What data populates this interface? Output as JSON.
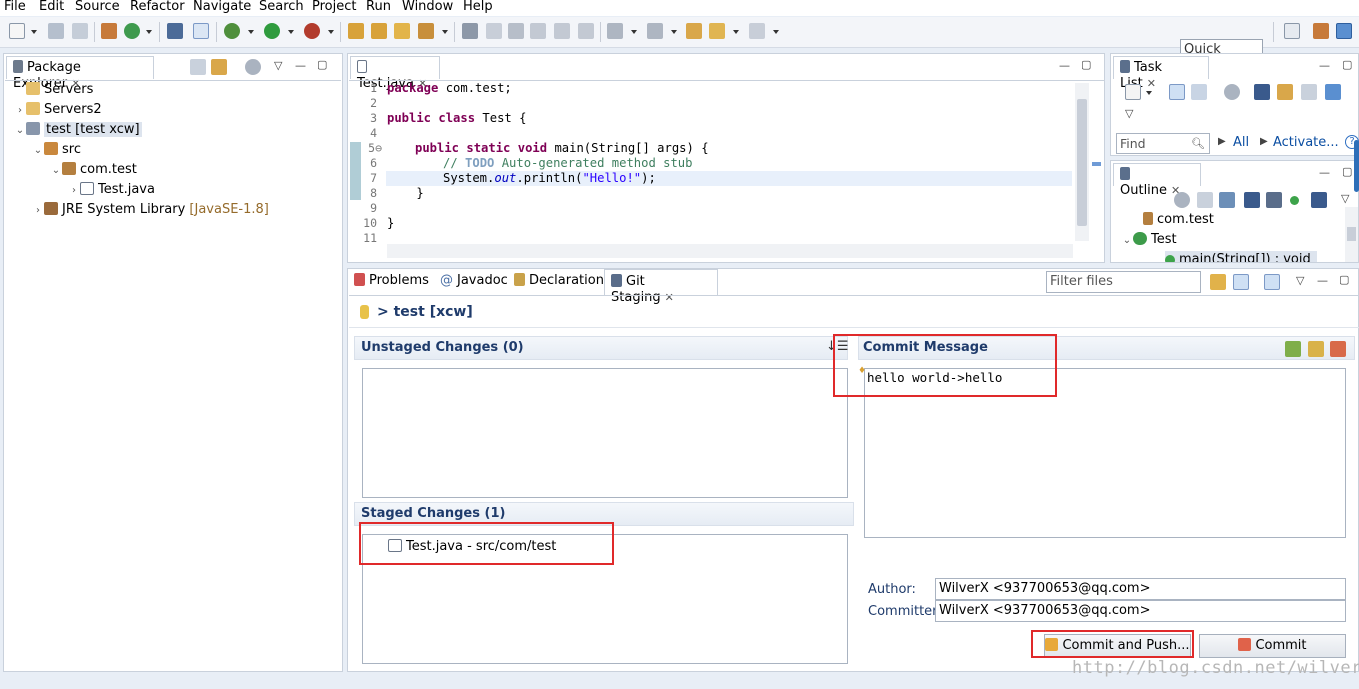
{
  "menu": [
    "File",
    "Edit",
    "Source",
    "Refactor",
    "Navigate",
    "Search",
    "Project",
    "Run",
    "Window",
    "Help"
  ],
  "quick_access": "Quick Access",
  "package_explorer": {
    "tab_label": "Package Explorer",
    "tree": [
      {
        "label": "Servers",
        "extra": "",
        "twisty": "",
        "icon": "folder-icon"
      },
      {
        "label": "Servers2",
        "extra": "",
        "twisty": "›",
        "icon": "folder-icon"
      },
      {
        "label": "test [test xcw]",
        "extra": "",
        "twisty": "⌄",
        "icon": "java-project-icon"
      },
      {
        "label": "src",
        "extra": "",
        "twisty": "⌄",
        "icon": "source-folder-icon"
      },
      {
        "label": "com.test",
        "extra": "",
        "twisty": "⌄",
        "icon": "package-icon"
      },
      {
        "label": "Test.java",
        "extra": "",
        "twisty": "›",
        "icon": "java-file-icon"
      },
      {
        "label": "JRE System Library",
        "extra": "[JavaSE-1.8]",
        "twisty": "›",
        "icon": "library-icon"
      }
    ]
  },
  "editor": {
    "tab_label": "Test.java",
    "line_numbers": [
      "1",
      "2",
      "3",
      "4",
      "5⊖",
      "6",
      "7",
      "8",
      "9",
      "10",
      "11"
    ]
  },
  "code": {
    "l1_kw": "package",
    "l1_rest": " com.test;",
    "l3_kw1": "public",
    "l3_kw2": "class",
    "l3_rest": " Test {",
    "l5_kw1": "public",
    "l5_kw2": "static",
    "l5_kw3": "void",
    "l5_rest": " main(String[] args) {",
    "l6_cm1": "// ",
    "l6_todo": "TODO",
    "l6_cm2": " Auto-generated method stub",
    "l7_a": "System.",
    "l7_fld": "out",
    "l7_b": ".println(",
    "l7_str": "\"Hello!\"",
    "l7_c": ");",
    "l8": "    }",
    "l10": "}"
  },
  "task_list": {
    "tab_label": "Task List",
    "find_placeholder": "Find",
    "all_link": "All",
    "activate_link": "Activate..."
  },
  "outline": {
    "tab_label": "Outline",
    "items": [
      "com.test",
      "Test",
      "main(String[]) : void"
    ]
  },
  "bottom_tabs": [
    "Problems",
    "Javadoc",
    "Declaration",
    "Git Staging"
  ],
  "filter_placeholder": "Filter files",
  "git_staging": {
    "repo_title": "> test [xcw]",
    "unstaged_title": "Unstaged Changes (0)",
    "staged_title": "Staged Changes (1)",
    "staged_files": [
      "Test.java - src/com/test"
    ],
    "commit_message_title": "Commit Message",
    "commit_message": "hello world->hello",
    "author_label": "Author:",
    "author_value": "WilverX <937700653@qq.com>",
    "committer_label": "Committer:",
    "committer_value": "WilverX <937700653@qq.com>",
    "commit_and_push_label": "Commit and Push...",
    "commit_label": "Commit"
  },
  "watermark": "http://blog.csdn.net/wilver",
  "colors": {
    "annotation_red": "#e0292a",
    "title_blue": "#1f3b6b",
    "current_line": "#e8f0fb"
  }
}
